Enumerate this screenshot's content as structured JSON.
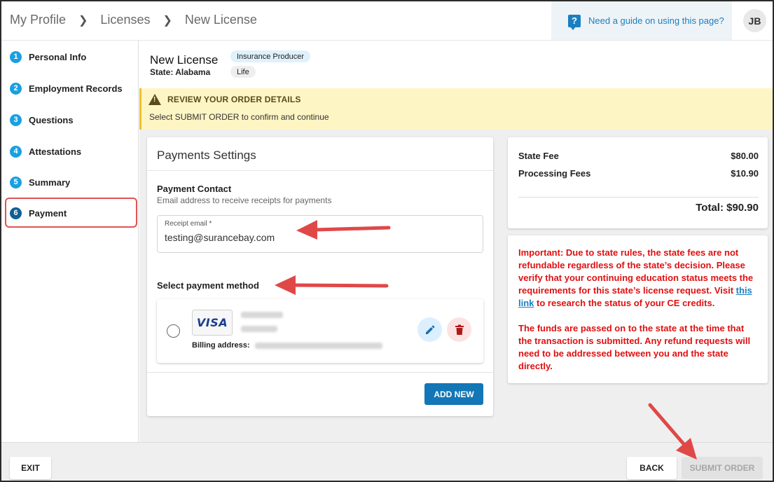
{
  "breadcrumb": [
    "My Profile",
    "Licenses",
    "New License"
  ],
  "guide": {
    "text": "Need a guide on using this page?",
    "icon": "question-icon"
  },
  "user": {
    "initials": "JB"
  },
  "steps": [
    {
      "num": "1",
      "label": "Personal Info"
    },
    {
      "num": "2",
      "label": "Employment Records"
    },
    {
      "num": "3",
      "label": "Questions"
    },
    {
      "num": "4",
      "label": "Attestations"
    },
    {
      "num": "5",
      "label": "Summary"
    },
    {
      "num": "6",
      "label": "Payment",
      "active": true
    }
  ],
  "license": {
    "title": "New License",
    "state": "State: Alabama",
    "type": "Insurance Producer",
    "line": "Life"
  },
  "banner": {
    "title": "REVIEW YOUR ORDER DETAILS",
    "message": "Select SUBMIT ORDER to confirm and continue"
  },
  "payment": {
    "title": "Payments Settings",
    "contact_title": "Payment Contact",
    "contact_sub": "Email address to receive receipts for payments",
    "email_label": "Receipt email *",
    "email_value": "testing@surancebay.com",
    "method_title": "Select payment method",
    "card_brand": "VISA",
    "billing_label": "Billing address:",
    "add_new": "ADD NEW"
  },
  "fees": {
    "rows": [
      {
        "label": "State Fee",
        "amount": "$80.00"
      },
      {
        "label": "Processing Fees",
        "amount": "$10.90"
      }
    ],
    "total": "Total: $90.90"
  },
  "notice": {
    "p1_before": "Important: Due to state rules, the state fees are not refundable regardless of the state’s decision. Please verify that your continuing education status meets the requirements for this state’s license request. Visit ",
    "p1_link": "this link",
    "p1_after": " to research the status of your CE credits.",
    "p2": "The funds are passed on to the state at the time that the transaction is submitted. Any refund requests will need to be addressed between you and the state directly."
  },
  "footer": {
    "exit": "EXIT",
    "back": "BACK",
    "submit": "SUBMIT ORDER"
  },
  "colors": {
    "accent": "#1376b6",
    "warning_bg": "#fdf5c4",
    "notice_text": "#e01010",
    "annotation": "#e04848"
  }
}
